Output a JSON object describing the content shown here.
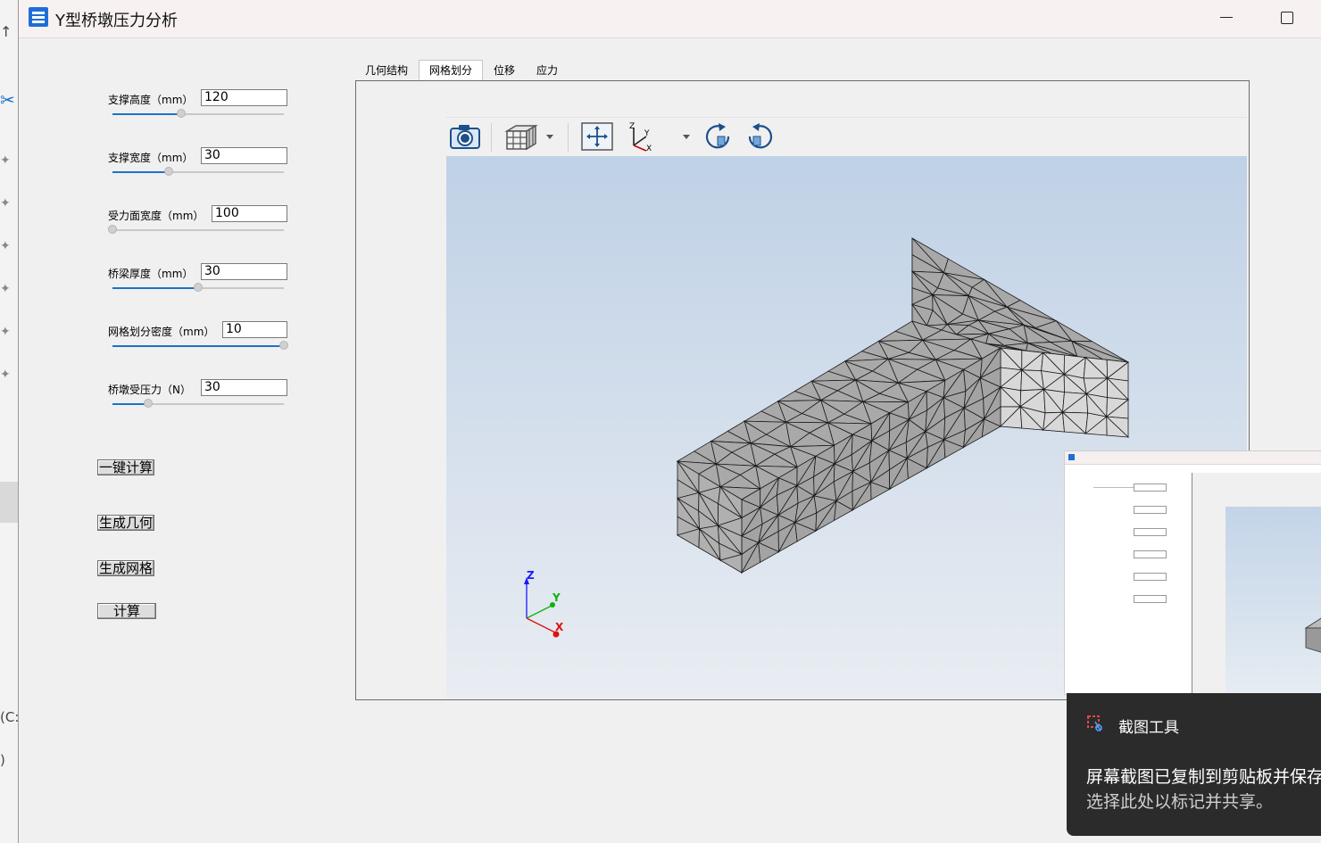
{
  "window": {
    "title": "Y型桥墩压力分析"
  },
  "params": [
    {
      "label": "支撑高度（mm）",
      "value": "120",
      "slider_fraction": 0.4
    },
    {
      "label": "支撑宽度（mm）",
      "value": "30",
      "slider_fraction": 0.33
    },
    {
      "label": "受力面宽度（mm）",
      "value": "100",
      "slider_fraction": 0.0
    },
    {
      "label": "桥梁厚度（mm）",
      "value": "30",
      "slider_fraction": 0.5
    },
    {
      "label": "网格划分密度（mm）",
      "value": "10",
      "slider_fraction": 1.0
    },
    {
      "label": "桥墩受压力（N）",
      "value": "30",
      "slider_fraction": 0.21
    }
  ],
  "buttons": {
    "one_click": "一键计算",
    "gen_geometry": "生成几何",
    "gen_mesh": "生成网格",
    "compute": "计算"
  },
  "tabs": [
    {
      "label": "几何结构",
      "active": false
    },
    {
      "label": "网格划分",
      "active": true
    },
    {
      "label": "位移",
      "active": false
    },
    {
      "label": "应力",
      "active": false
    }
  ],
  "toolbar_icons": [
    "camera-icon",
    "view-cube-icon",
    "fit-all-icon",
    "axes-icon",
    "rotate-cw-icon",
    "rotate-ccw-icon"
  ],
  "axes": {
    "x": "X",
    "y": "Y",
    "z": "Z"
  },
  "notification": {
    "app": "截图工具",
    "message": "屏幕截图已复制到剪贴板并保存",
    "sub": "选择此处以标记并共享。"
  },
  "background_app": {
    "text_c": "(C:",
    "text_paren": ")"
  },
  "colors": {
    "accent": "#1a74c8",
    "viewer_top": "#bfd1e6",
    "viewer_bottom": "#e9edf2",
    "mesh_fill": "#a9a9a9"
  }
}
